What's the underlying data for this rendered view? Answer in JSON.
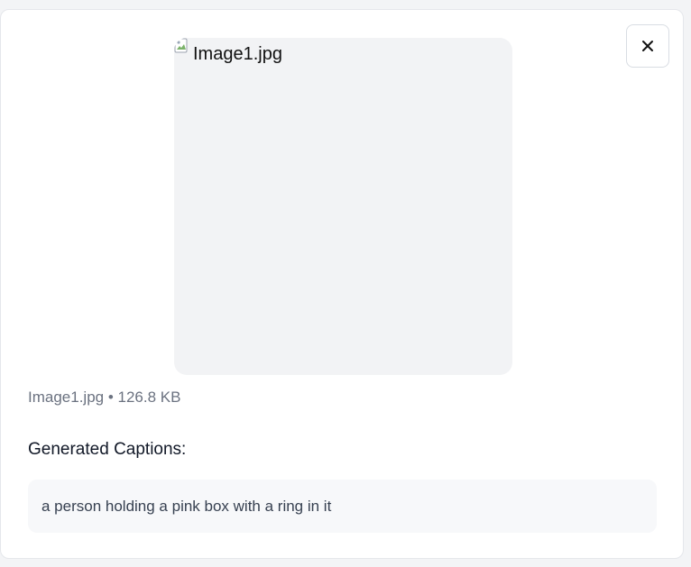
{
  "modal": {
    "close_icon": "close-icon",
    "image": {
      "alt_text": "Image1.jpg",
      "placeholder_color": "#f2f3f5",
      "broken_icon": "broken-image-icon"
    },
    "file_info": "Image1.jpg • 126.8 KB",
    "captions_heading": "Generated Captions:",
    "captions": [
      "a person holding a pink box with a ring in it"
    ]
  }
}
